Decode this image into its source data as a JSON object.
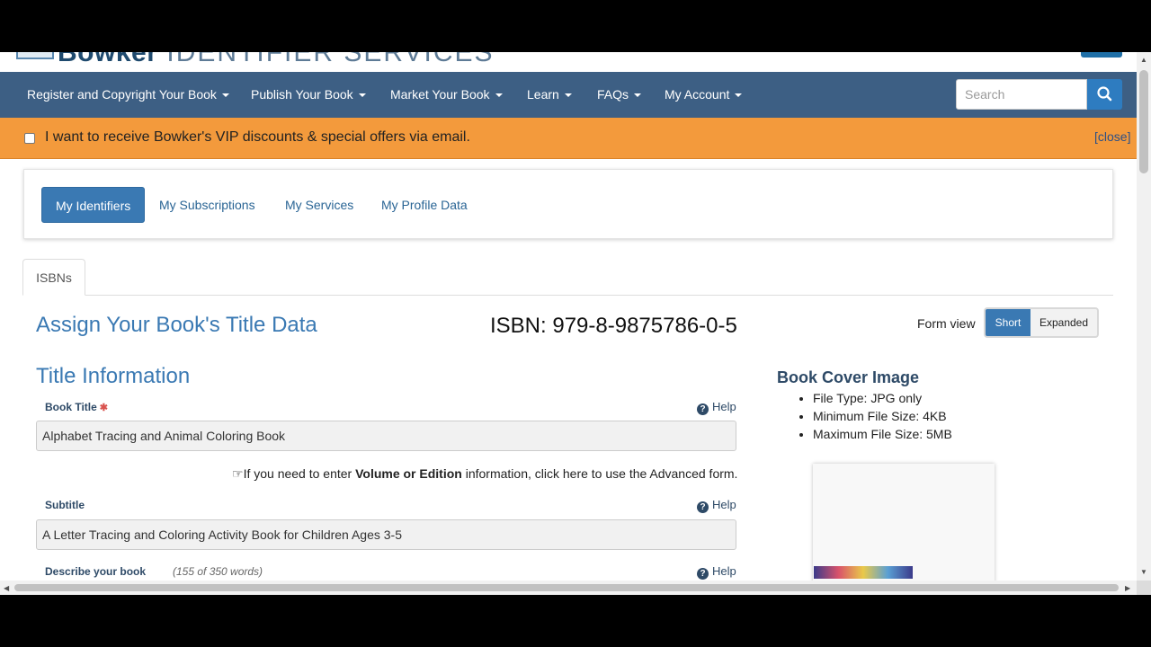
{
  "header": {
    "logo_text": "Bowker",
    "logo_subtext": "IDENTIFIER SERVICES"
  },
  "nav": {
    "items": [
      {
        "label": "Register and Copyright Your Book"
      },
      {
        "label": "Publish Your Book"
      },
      {
        "label": "Market Your Book"
      },
      {
        "label": "Learn"
      },
      {
        "label": "FAQs"
      },
      {
        "label": "My Account"
      }
    ],
    "search_placeholder": "Search",
    "search_icon": "search-icon"
  },
  "banner": {
    "text": "I want to receive Bowker's VIP discounts & special offers via email.",
    "close_label": "[close]",
    "checked": false
  },
  "account_tabs": {
    "items": [
      {
        "label": "My Identifiers",
        "active": true
      },
      {
        "label": "My Subscriptions",
        "active": false
      },
      {
        "label": "My Services",
        "active": false
      },
      {
        "label": "My Profile Data",
        "active": false
      }
    ]
  },
  "content_tabs": {
    "items": [
      {
        "label": "ISBNs"
      }
    ]
  },
  "page": {
    "title": "Assign Your Book's Title Data",
    "isbn": "ISBN: 979-8-9875786-0-5",
    "form_view_label": "Form view",
    "form_view_options": [
      "Short",
      "Expanded"
    ],
    "form_view_selected": "Short"
  },
  "title_info": {
    "heading": "Title Information",
    "book_title_label": "Book Title",
    "required_marker": "✱",
    "book_title_value": "Alphabet Tracing and Animal Coloring Book",
    "help_label": "Help",
    "advanced_note_prefix": "If you need to enter ",
    "advanced_note_bold": "Volume or Edition",
    "advanced_note_suffix": " information, click here to use the Advanced form.",
    "advanced_icon": "pointing-hand-icon",
    "subtitle_label": "Subtitle",
    "subtitle_value": "A Letter Tracing and Coloring Activity Book for Children Ages 3-5",
    "describe_label": "Describe your book",
    "describe_count": "(155 of 350 words)"
  },
  "cover": {
    "heading": "Book Cover Image",
    "requirements": [
      "File Type: JPG only",
      "Minimum File Size: 4KB",
      "Maximum File Size: 5MB"
    ]
  },
  "colors": {
    "nav_bg": "#3d5f84",
    "banner_bg": "#f39a3c",
    "accent": "#3a79b3"
  }
}
